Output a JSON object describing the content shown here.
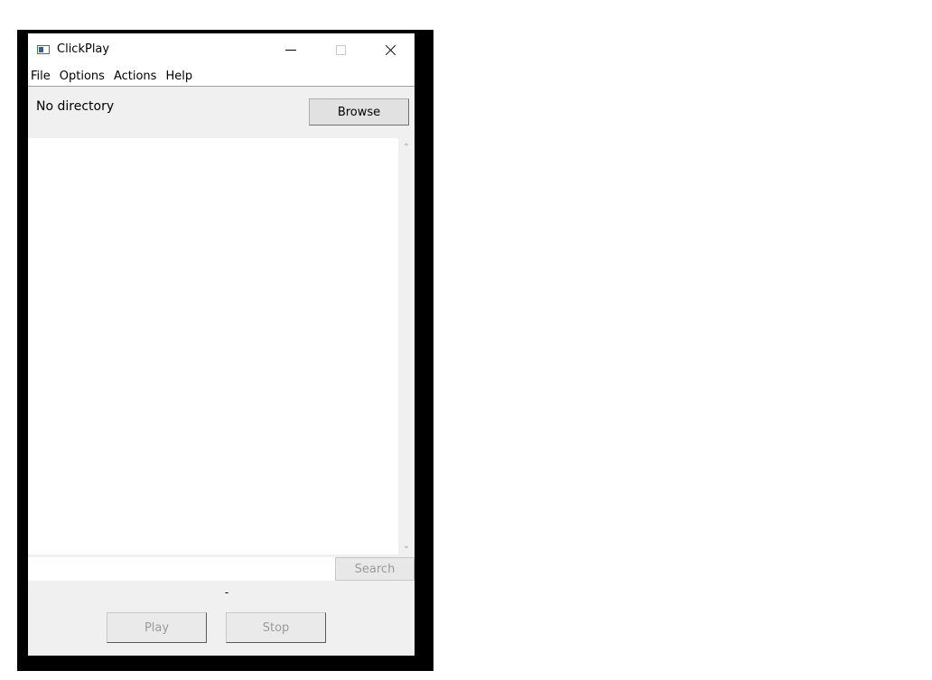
{
  "window": {
    "title": "ClickPlay",
    "controls": {
      "minimize": "minimize-icon",
      "maximize": "maximize-icon",
      "close": "close-icon"
    }
  },
  "menubar": {
    "items": [
      {
        "label": "File"
      },
      {
        "label": "Options"
      },
      {
        "label": "Actions"
      },
      {
        "label": "Help"
      }
    ]
  },
  "directory": {
    "label": "No directory",
    "browse_label": "Browse"
  },
  "file_list": {
    "items": []
  },
  "search": {
    "value": "",
    "button_label": "Search",
    "button_enabled": false
  },
  "status": {
    "text": "-"
  },
  "playback": {
    "play_label": "Play",
    "stop_label": "Stop",
    "play_enabled": false,
    "stop_enabled": false
  },
  "colors": {
    "window_bg": "#f0f0f0",
    "list_bg": "#ffffff",
    "disabled_text": "#9a9a9a",
    "frame": "#000000"
  }
}
